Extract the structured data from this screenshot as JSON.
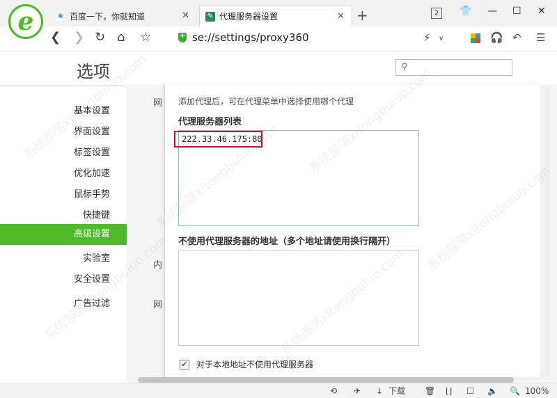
{
  "tabs": [
    {
      "label": "百度一下，你就知道",
      "icon": "baidu-paw-icon"
    },
    {
      "label": "代理服务器设置",
      "icon": "wrench-icon"
    }
  ],
  "tab_count": "2",
  "address": {
    "url": "se://settings/proxy360"
  },
  "settings": {
    "title": "选项",
    "search_placeholder": ""
  },
  "sidebar": {
    "items": [
      {
        "label": "基本设置"
      },
      {
        "label": "界面设置"
      },
      {
        "label": "标签设置"
      },
      {
        "label": "优化加速"
      },
      {
        "label": "鼠标手势"
      },
      {
        "label": "快捷键"
      },
      {
        "label": "高级设置"
      },
      {
        "label": "实验室"
      },
      {
        "label": "安全设置"
      },
      {
        "label": "广告过滤"
      }
    ],
    "active": "高级设置"
  },
  "under": {
    "label1": "网",
    "label2": "内",
    "label3": "网"
  },
  "proxy": {
    "hint": "添加代理后，可在代理菜单中选择使用哪个代理",
    "list_label": "代理服务器列表",
    "list_value": "222.33.46.175:80",
    "bypass_label": "不使用代理服务器的地址（多个地址请使用换行隔开）",
    "bypass_value": "",
    "local_checkbox_label": "对于本地地址不使用代理服务器",
    "local_checked": true
  },
  "status": {
    "download": "下载",
    "zoom": "100%"
  },
  "watermark": "系统部落xitongbuluo.com",
  "colors": {
    "accent": "#4cba29",
    "highlight_box": "#c8102e"
  }
}
